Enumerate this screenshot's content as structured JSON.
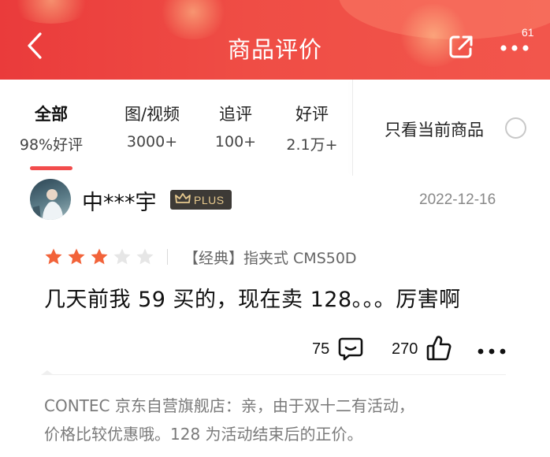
{
  "header": {
    "title": "商品评价",
    "back_icon": "chevron-left-icon",
    "share_icon": "share-icon",
    "more_icon": "more-dots-icon",
    "more_badge": "61",
    "background_color": "#ee4742"
  },
  "filters": {
    "tabs": [
      {
        "label": "全部",
        "count": "98%好评",
        "active": true
      },
      {
        "label": "图/视频",
        "count": "3000+",
        "active": false
      },
      {
        "label": "追评",
        "count": "100+",
        "active": false
      },
      {
        "label": "好评",
        "count": "2.1万+",
        "active": false
      }
    ],
    "current_only_label": "只看当前商品",
    "current_only_checked": false,
    "accent_color": "#f24c4c"
  },
  "review": {
    "username": "中***宇",
    "badge": "PLUS",
    "date": "2022-12-16",
    "rating": 3,
    "rating_max": 5,
    "variant": "【经典】指夹式 CMS50D",
    "text": "几天前我 59 买的，现在卖 128。。。厉害啊",
    "comment_count": "75",
    "like_count": "270",
    "star_color": "#f2633a"
  },
  "reply": {
    "line1": "CONTEC 京东自营旗舰店：亲，由于双十二有活动，",
    "line2": "价格比较优惠哦。128 为活动结束后的正价。"
  }
}
